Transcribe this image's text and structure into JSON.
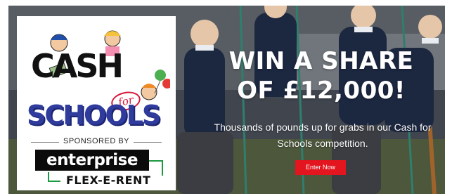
{
  "logo": {
    "cash_word": "CASH",
    "for_word": "for",
    "schools_word": "SCHOOLS",
    "sponsored_by": "SPONSORED BY",
    "sponsor_name": "enterprise",
    "sponsor_product": "FLEX-E-RENT"
  },
  "headline": {
    "line1": "WIN A SHARE",
    "line2": "OF £12,000!"
  },
  "subtext": {
    "line1": "Thousands of pounds up for grabs in our Cash for",
    "line2": "Schools competition."
  },
  "cta": {
    "label": "Enter Now"
  },
  "colors": {
    "cta_red": "#e3151e",
    "schools_blue": "#2f3c9e",
    "for_red": "#d7193a",
    "enterprise_green": "#1c9a40",
    "uniform_navy": "#1c2740"
  }
}
